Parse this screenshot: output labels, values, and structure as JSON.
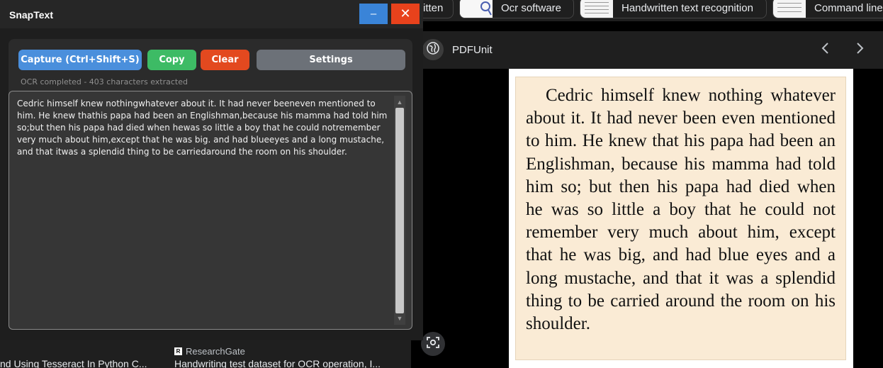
{
  "app": {
    "title": "SnapText",
    "minimize_symbol": "–",
    "close_symbol": "✕",
    "toolbar": {
      "capture_label": "Capture (Ctrl+Shift+S)",
      "copy_label": "Copy",
      "clear_label": "Clear",
      "settings_label": "Settings"
    },
    "status": "OCR completed - 403 characters extracted",
    "ocr_text": "Cedric himself knew nothingwhatever about it. It had never beeneven mentioned to him. He knew thathis papa had been an Englishman,because his mamma had told him so;but then his papa had died when hewas so little a boy that he could notremember very much about him,except that he was big. and had blueeyes and a long mustache, and that itwas a splendid thing to be carriedaround the room on his shoulder.",
    "colors": {
      "capture": "#4a8fdc",
      "copy": "#3dbb65",
      "clear": "#e3491f",
      "settings": "#6c7178"
    }
  },
  "browser": {
    "chips": [
      {
        "label": "itten"
      },
      {
        "label": "Ocr software"
      },
      {
        "label": "Handwritten text recognition"
      },
      {
        "label": "Command line"
      }
    ],
    "viewer": {
      "site_name": "PDFUnit",
      "prev_icon": "chevron-left-icon",
      "next_icon": "chevron-right-icon"
    },
    "document_text": "Cedric himself knew nothing whatever about it. It had never been even mentioned to him. He knew that his papa had been an Englishman, because his mamma had told him so; but then his papa had died when he was so little a boy that he could not remember very much about him, except that he was big, and had blue eyes and a long mustache, and that it was a splendid thing to be carried around the room on his shoulder.",
    "results": {
      "left_title": "nd Using Tesseract In Python C...",
      "right_source": "ResearchGate",
      "right_source_favicon": "R",
      "right_title": "Handwriting test dataset for OCR operation, I..."
    }
  }
}
